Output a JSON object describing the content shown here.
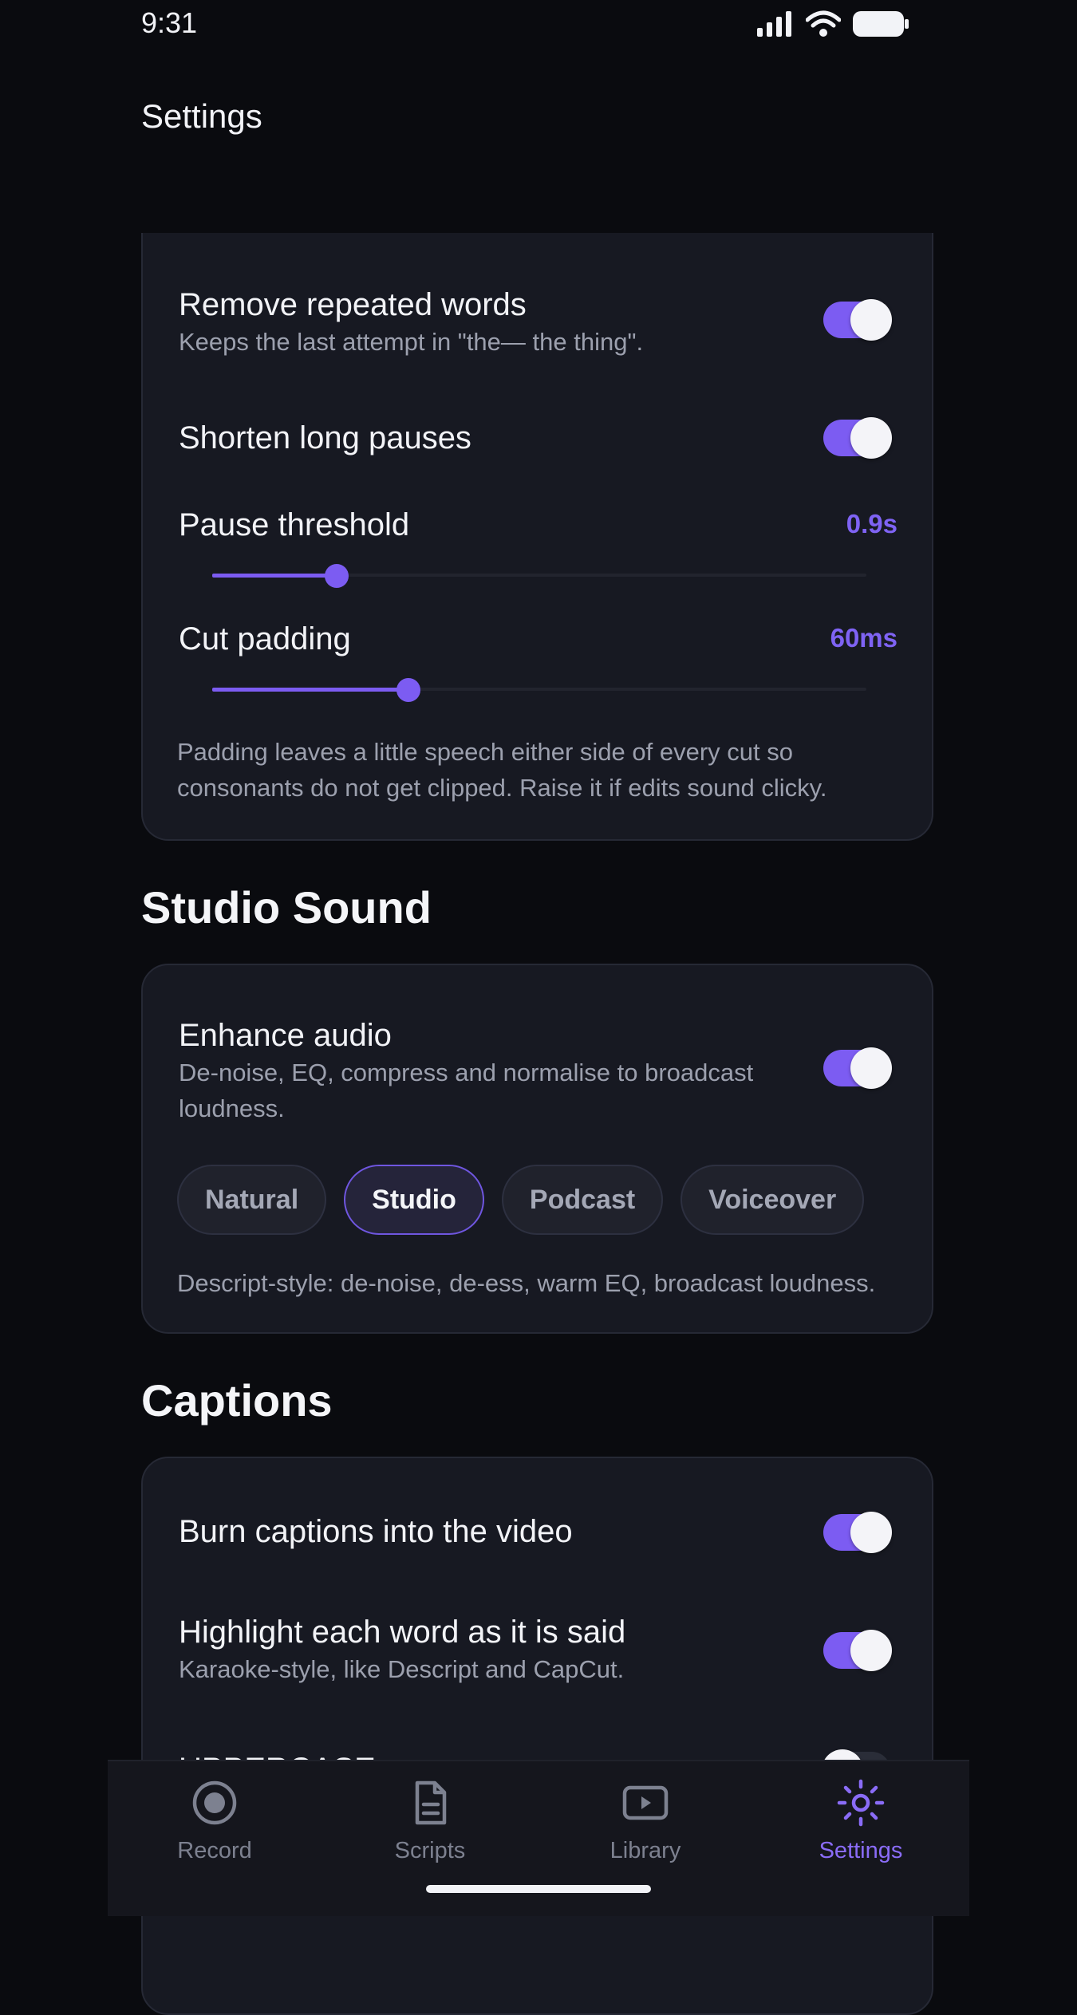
{
  "status_bar": {
    "time": "9:31"
  },
  "header": {
    "title": "Settings"
  },
  "cleanup": {
    "remove_repeated": {
      "title": "Remove repeated words",
      "subtitle": "Keeps the last attempt in \"the— the thing\".",
      "on": true
    },
    "shorten_pauses": {
      "title": "Shorten long pauses",
      "on": true
    },
    "pause_threshold": {
      "label": "Pause threshold",
      "value": "0.9s",
      "fill_fraction": 0.19
    },
    "cut_padding": {
      "label": "Cut padding",
      "value": "60ms",
      "fill_fraction": 0.3
    },
    "note": "Padding leaves a little speech either side of every cut so consonants do not get clipped. Raise it if edits sound clicky."
  },
  "studio_sound": {
    "heading": "Studio Sound",
    "enhance": {
      "title": "Enhance audio",
      "subtitle": "De-noise, EQ, compress and normalise to broadcast loudness.",
      "on": true
    },
    "presets": [
      {
        "label": "Natural",
        "active": false
      },
      {
        "label": "Studio",
        "active": true
      },
      {
        "label": "Podcast",
        "active": false
      },
      {
        "label": "Voiceover",
        "active": false
      }
    ],
    "preset_description": "Descript-style: de-noise, de-ess, warm EQ, broadcast loudness."
  },
  "captions": {
    "heading": "Captions",
    "burn": {
      "title": "Burn captions into the video",
      "on": true
    },
    "highlight": {
      "title": "Highlight each word as it is said",
      "subtitle": "Karaoke-style, like Descript and CapCut.",
      "on": true
    },
    "uppercase": {
      "title": "UPPERCASE",
      "on": false
    }
  },
  "nav": {
    "items": [
      {
        "label": "Record",
        "icon": "record-icon",
        "active": false
      },
      {
        "label": "Scripts",
        "icon": "document-icon",
        "active": false
      },
      {
        "label": "Library",
        "icon": "play-icon",
        "active": false
      },
      {
        "label": "Settings",
        "icon": "gear-icon",
        "active": true
      }
    ]
  },
  "colors": {
    "accent": "#7c5cf2",
    "background": "#0a0b0f",
    "card": "#171922",
    "muted_text": "#9ca0ae"
  }
}
